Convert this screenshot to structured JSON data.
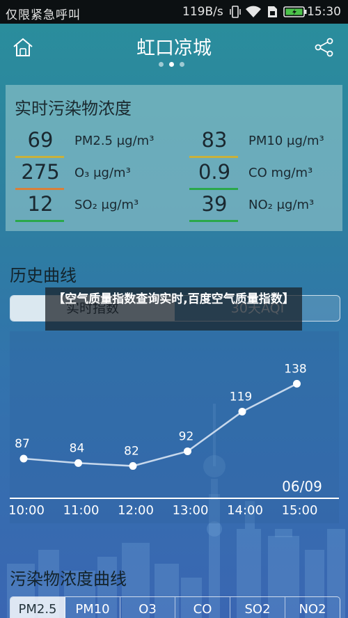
{
  "status_bar": {
    "carrier": "仅限紧急呼叫",
    "net_speed": "119B/s",
    "time": "15:30"
  },
  "header": {
    "title": "虹口凉城",
    "page_count": 3,
    "active_page": 1
  },
  "realtime": {
    "heading": "实时污染物浓度",
    "metrics": [
      {
        "value": "69",
        "unit": "PM2.5 μg/m³",
        "color": "#c9b13a"
      },
      {
        "value": "83",
        "unit": "PM10 μg/m³",
        "color": "#c9b13a"
      },
      {
        "value": "275",
        "unit": "O₃ μg/m³",
        "color": "#d9803a"
      },
      {
        "value": "0.9",
        "unit": "CO mg/m³",
        "color": "#2aa84a"
      },
      {
        "value": "12",
        "unit": "SO₂ μg/m³",
        "color": "#2aa84a"
      },
      {
        "value": "39",
        "unit": "NO₂ μg/m³",
        "color": "#2aa84a"
      }
    ]
  },
  "history": {
    "heading": "历史曲线",
    "tab_left": "实时指数",
    "tab_right": "30天AQI",
    "date": "06/09"
  },
  "overlay": {
    "text": "【空气质量指数查询实时,百度空气质量指数】"
  },
  "pollutant_curve": {
    "heading": "污染物浓度曲线",
    "tabs": [
      "PM2.5",
      "PM10",
      "O3",
      "CO",
      "SO2",
      "NO2"
    ],
    "active_tab": 0
  },
  "chart_data": {
    "type": "line",
    "x": [
      "10:00",
      "11:00",
      "12:00",
      "13:00",
      "14:00",
      "15:00"
    ],
    "values": [
      87,
      84,
      82,
      92,
      119,
      138
    ],
    "ylim": [
      60,
      150
    ],
    "grid": false,
    "line_color": "#c7d8ec",
    "point_color": "#ffffff"
  }
}
